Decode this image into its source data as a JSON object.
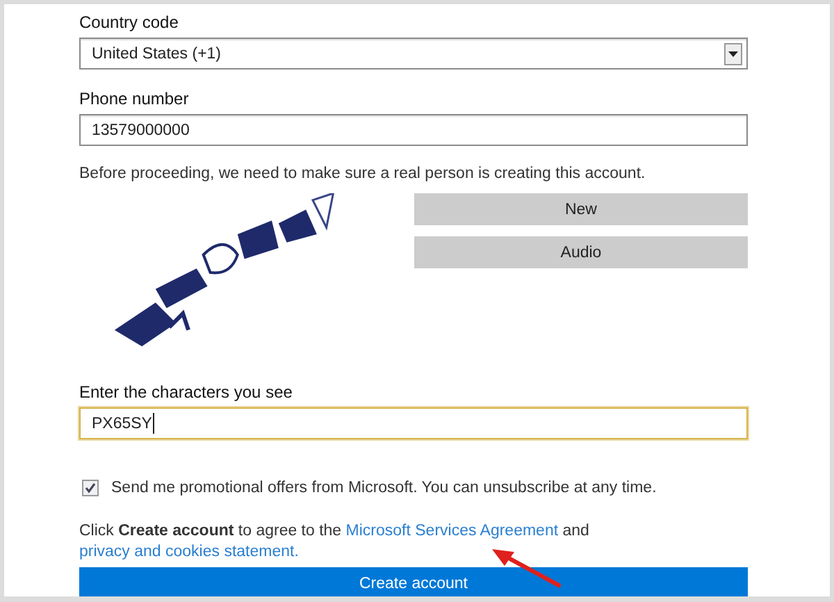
{
  "country": {
    "label": "Country code",
    "value": "United States (+1)"
  },
  "phone": {
    "label": "Phone number",
    "value": "13579000000"
  },
  "notice": "Before proceeding, we need to make sure a real person is creating this account.",
  "captcha": {
    "kind": "picture",
    "buttons": [
      "New",
      "Audio"
    ]
  },
  "characters": {
    "label": "Enter the characters you see",
    "value": "PX65SY",
    "focused": true
  },
  "promo": {
    "label": "Send me promotional offers from Microsoft. You can unsubscribe at any time.",
    "checked": true
  },
  "agreement": {
    "before": "Click **Create account** to agree to the ",
    "link_1": "Microsoft Services Agreement",
    "middle": " and ",
    "link_2": "privacy and cookies statement."
  },
  "submit": "Create account"
}
